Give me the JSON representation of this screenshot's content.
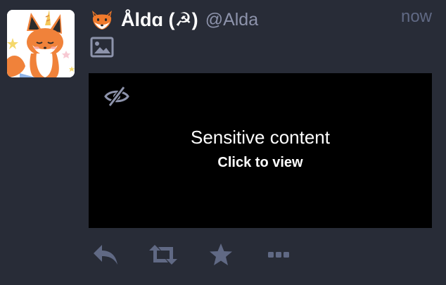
{
  "status": {
    "display_name": "Åldɑ (☭)",
    "handle": "@Alda",
    "timestamp": "now",
    "sensitive": {
      "title": "Sensitive content",
      "subtitle": "Click to view"
    },
    "icons": {
      "avatar": "fox-unicorn-avatar",
      "name_emoji": "fox-emoji-icon",
      "media": "image-icon",
      "visibility": "eye-slash-icon",
      "reply": "reply-icon",
      "boost": "boost-icon",
      "favourite": "star-icon",
      "more": "ellipsis-icon"
    }
  },
  "colors": {
    "background": "#282c37",
    "media_background": "#000000",
    "action_icon": "#606984",
    "handle": "#8d93ab"
  }
}
